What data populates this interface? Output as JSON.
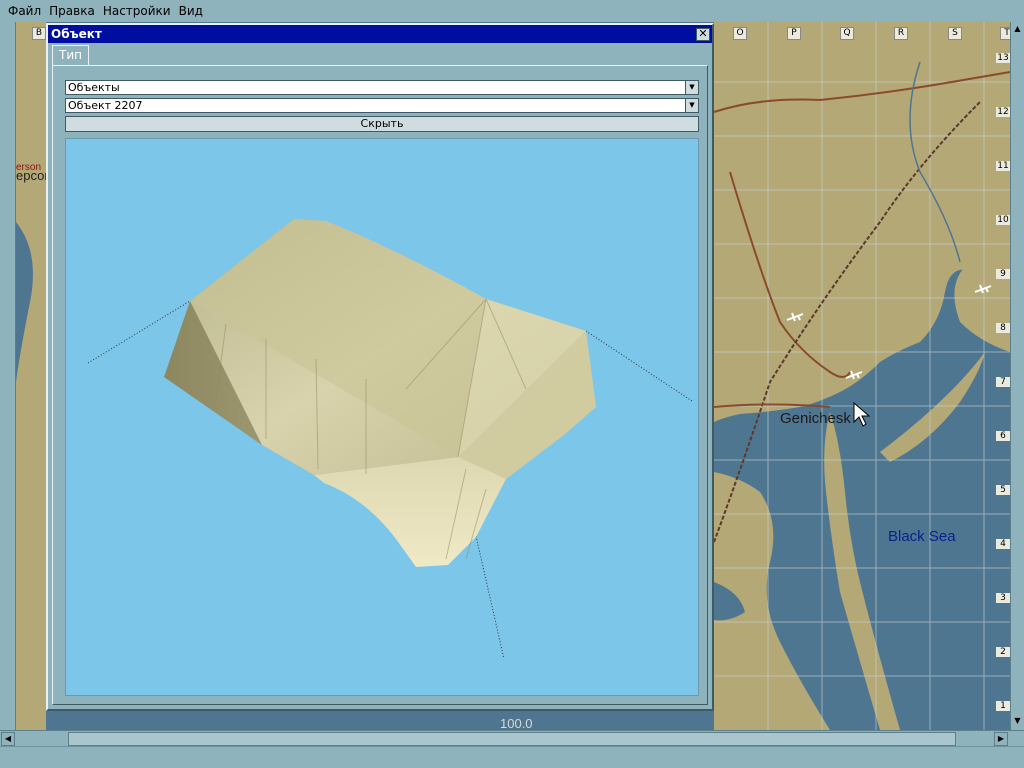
{
  "menu": [
    "Файл",
    "Правка",
    "Настройки",
    "Вид"
  ],
  "map": {
    "columns": [
      "B",
      "O",
      "P",
      "Q",
      "R",
      "S",
      "T"
    ],
    "rows": [
      "13",
      "12",
      "11",
      "10",
      "9",
      "8",
      "7",
      "6",
      "5",
      "4",
      "3",
      "2",
      "1"
    ],
    "labels": {
      "city": "Genichesk",
      "sea": "Black Sea",
      "scale": "100.0",
      "left_partial": "erson",
      "left_partial2": "ерсон"
    },
    "colors": {
      "water": "#4f7691",
      "land": "#b4a877",
      "road": "#8b4a2c",
      "grid": "#cbd4d6"
    }
  },
  "dialog": {
    "title": "Объект",
    "close_icon": "close-icon",
    "tab": "Тип",
    "category_select": "Объекты",
    "object_select": "Объект 2207",
    "hide_button": "Скрыть",
    "viewport_bg": "#7cc6ea"
  }
}
